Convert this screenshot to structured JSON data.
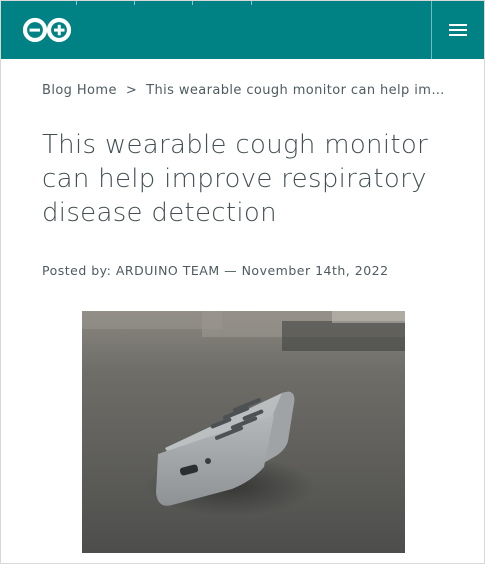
{
  "header": {
    "logo_name": "arduino-logo",
    "brand_color": "#008184",
    "menu_icon": "hamburger-menu-icon"
  },
  "breadcrumb": {
    "home_label": "Blog Home",
    "separator": ">",
    "current_label": "This wearable cough monitor can help improve respiratory disease detection"
  },
  "article": {
    "title": "This wearable cough monitor can help improve respiratory disease detection",
    "byline_prefix": "Posted by:",
    "author": "ARDUINO TEAM",
    "dash": "—",
    "date": "November 14th, 2022"
  },
  "image": {
    "subject": "grey 3d-printed wearable cough monitor device on desk"
  }
}
